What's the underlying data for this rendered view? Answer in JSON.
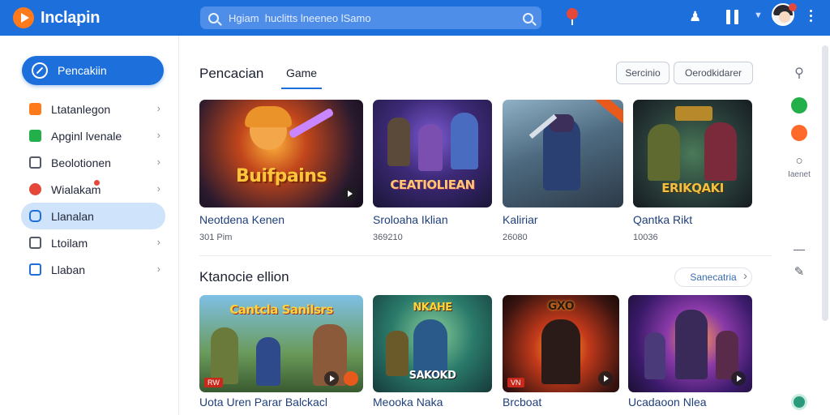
{
  "app": {
    "title": "Inclapin"
  },
  "search": {
    "placeholder": "Hgiam  huclitts lneeneo lSamo"
  },
  "colors": {
    "accent": "#1d6fdc",
    "active_nav": "#cfe3fb",
    "orange": "#ff7a1a",
    "red": "#e5483a",
    "green": "#23b04b"
  },
  "sidebar": {
    "primary_button": "Pencakiin",
    "items": [
      {
        "label": "Ltatanlegon",
        "icon": "orange-tag-icon",
        "active": false
      },
      {
        "label": "Apginl lvenale",
        "icon": "green-x-icon",
        "active": false
      },
      {
        "label": "Beolotionen",
        "icon": "chat-bubble-icon",
        "active": false
      },
      {
        "label": "Wialakam",
        "icon": "red-record-icon",
        "active": false
      },
      {
        "label": "Llanalan",
        "icon": "chat-icon",
        "active": true
      },
      {
        "label": "Ltoilam",
        "icon": "clipboard-icon",
        "active": false
      },
      {
        "label": "Llaban",
        "icon": "window-icon",
        "active": false
      }
    ]
  },
  "main": {
    "section1": {
      "title": "Pencacian",
      "tab": "Game",
      "filters": [
        "Sercinio",
        "Oerodkidarer"
      ],
      "cards": [
        {
          "name": "Neotdena Kenen",
          "meta": "301 Pim",
          "art_title": "Buifpains"
        },
        {
          "name": "Sroloaha Iklian",
          "meta": "369210",
          "art_title": "CEATIOLIEAN"
        },
        {
          "name": "Kaliriar",
          "meta": "26080",
          "art_title": ""
        },
        {
          "name": "Qantka Rikt",
          "meta": "10036",
          "art_title": "ERIKQAKI"
        }
      ]
    },
    "section2": {
      "title": "Ktanocie ellion",
      "see_all": "Sanecatria",
      "cards": [
        {
          "name": "Uota Uren Parar Balckacl",
          "art_title": "Cantcla Sanilsrs",
          "tag": "RW"
        },
        {
          "name": "Meooka Naka",
          "art_title": "NKAHE",
          "tag": "SAKOKD"
        },
        {
          "name": "Brcboat",
          "art_title": "GXO",
          "tag": "VN"
        },
        {
          "name": "Ucadaoon Nlea",
          "art_title": "",
          "tag": ""
        }
      ]
    }
  },
  "rail": {
    "label": "Iaenet"
  }
}
